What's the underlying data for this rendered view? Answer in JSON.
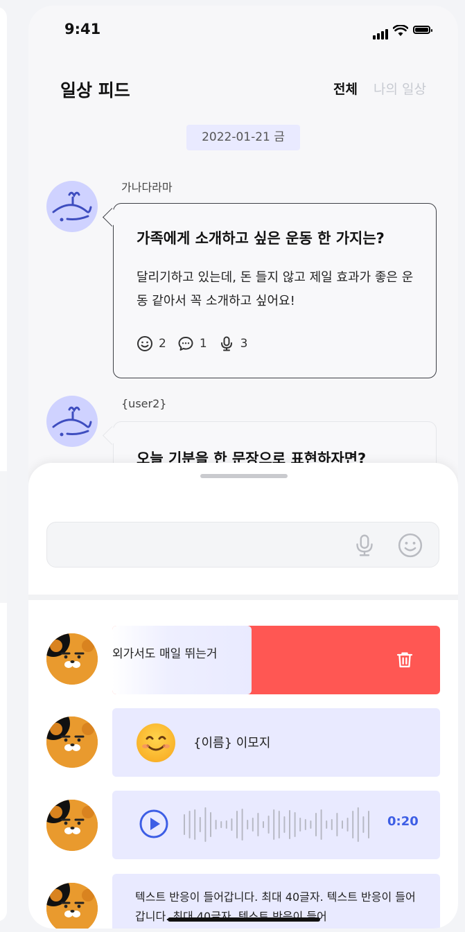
{
  "status_bar": {
    "time": "9:41"
  },
  "header": {
    "title": "일상 피드",
    "tabs": [
      {
        "label": "전체",
        "active": true
      },
      {
        "label": "나의 일상",
        "active": false
      }
    ]
  },
  "feed": {
    "date": "2022-01-21 금",
    "posts": [
      {
        "user": "가나다라마",
        "question": "가족에게 소개하고 싶은 운동 한 가지는?",
        "answer": "달리기하고 있는데, 돈 들지 않고 제일 효과가 좋은 운동 같아서 꼭 소개하고 싶어요!",
        "counts": {
          "emoji": "2",
          "comment": "1",
          "voice": "3"
        }
      },
      {
        "user": "{user2}",
        "question": "오늘 기분을 한 문장으로 표현하자면?"
      }
    ]
  },
  "sheet": {
    "input": {
      "placeholder": "",
      "value": ""
    },
    "reactions": [
      {
        "type": "text-swiped",
        "text": "외가서도 매일 뛰는거",
        "action": "delete"
      },
      {
        "type": "emoji",
        "label": "{이름} 이모지"
      },
      {
        "type": "voice",
        "duration": "0:20"
      },
      {
        "type": "text",
        "text": "텍스트 반응이 들어갑니다. 최대 40글자. 텍스트 반응이 들어갑니다. 최대 40글자. 텍스트 반응이 들어"
      }
    ]
  },
  "colors": {
    "accent": "#3d5ee5",
    "card_bg": "#e9eaff",
    "delete_red": "#ff5753",
    "avatar_bg": "#cfd2ff"
  },
  "icons": [
    "signal-icon",
    "wifi-icon",
    "battery-icon",
    "smile-icon",
    "comment-icon",
    "mic-icon",
    "trash-icon",
    "play-icon"
  ]
}
